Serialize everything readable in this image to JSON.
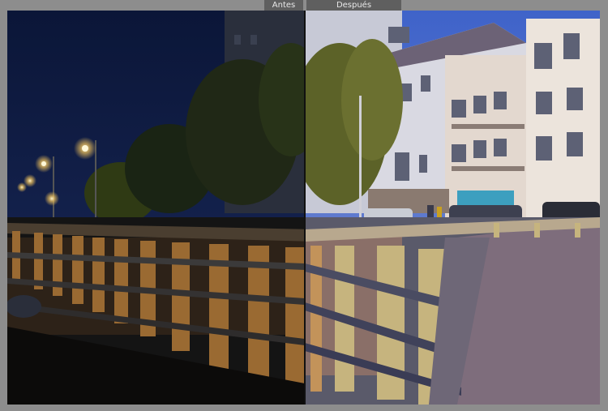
{
  "compare": {
    "before_label": "Antes",
    "after_label": "Después"
  },
  "colors": {
    "chrome_background": "#8d8d8d",
    "label_background": "#5f5f5f",
    "label_text": "#e8e8e8"
  }
}
